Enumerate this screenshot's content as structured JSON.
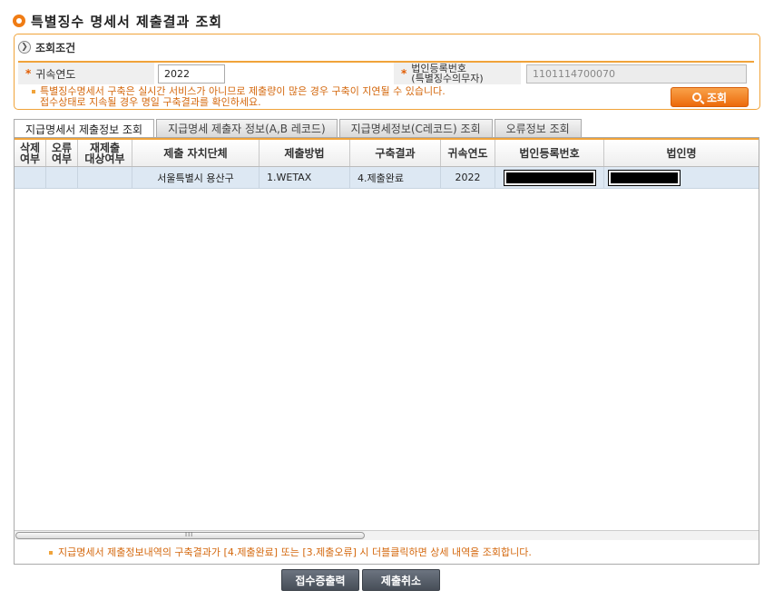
{
  "page": {
    "title": "특별징수 명세서 제출결과 조회"
  },
  "conditions": {
    "header": "조회조건",
    "year_label": "귀속연도",
    "year_value": "2022",
    "biz_label_line1": "법인등록번호",
    "biz_label_line2": "(특별징수의무자)",
    "biz_value": "1101114700070",
    "notice_line1": "특별징수명세서 구축은 실시간 서비스가 아니므로 제출량이 많은 경우 구축이 지연될 수 있습니다.",
    "notice_line2": "접수상태로 지속될 경우 명일 구축결과를 확인하세요.",
    "search_label": "조회",
    "required_mark": "*"
  },
  "tabs": [
    {
      "label": "지급명세서 제출정보 조회",
      "active": true
    },
    {
      "label": "지급명세 제출자 정보(A,B 레코드)",
      "active": false
    },
    {
      "label": "지급명세정보(C레코드) 조회",
      "active": false
    },
    {
      "label": "오류정보 조회",
      "active": false
    }
  ],
  "grid": {
    "columns": [
      {
        "line1": "삭제",
        "line2": "여부"
      },
      {
        "line1": "오류",
        "line2": "여부"
      },
      {
        "line1": "재제출",
        "line2": "대상여부"
      },
      {
        "line1": "제출 자치단체",
        "line2": ""
      },
      {
        "line1": "제출방법",
        "line2": ""
      },
      {
        "line1": "구축결과",
        "line2": ""
      },
      {
        "line1": "귀속연도",
        "line2": ""
      },
      {
        "line1": "법인등록번호",
        "line2": ""
      },
      {
        "line1": "법인명",
        "line2": ""
      }
    ],
    "rows": [
      {
        "del": "",
        "err": "",
        "resubmit": "",
        "region": "서울특별시 용산구",
        "method": "1.WETAX",
        "result": "4.제출완료",
        "year": "2022"
      }
    ],
    "scroll_grip": "III",
    "note": "지급명세서 제출정보내역의 구축결과가 [4.제출완료] 또는 [3.제출오류] 시 더블클릭하면 상세 내역을 조회합니다."
  },
  "buttons": {
    "receipt_print": "접수증출력",
    "cancel_submit": "제출취소"
  },
  "colors": {
    "accent": "#f07c14",
    "border_accent": "#f0a33a",
    "notice_text": "#d4680e",
    "row_selected": "#dde8f3"
  }
}
